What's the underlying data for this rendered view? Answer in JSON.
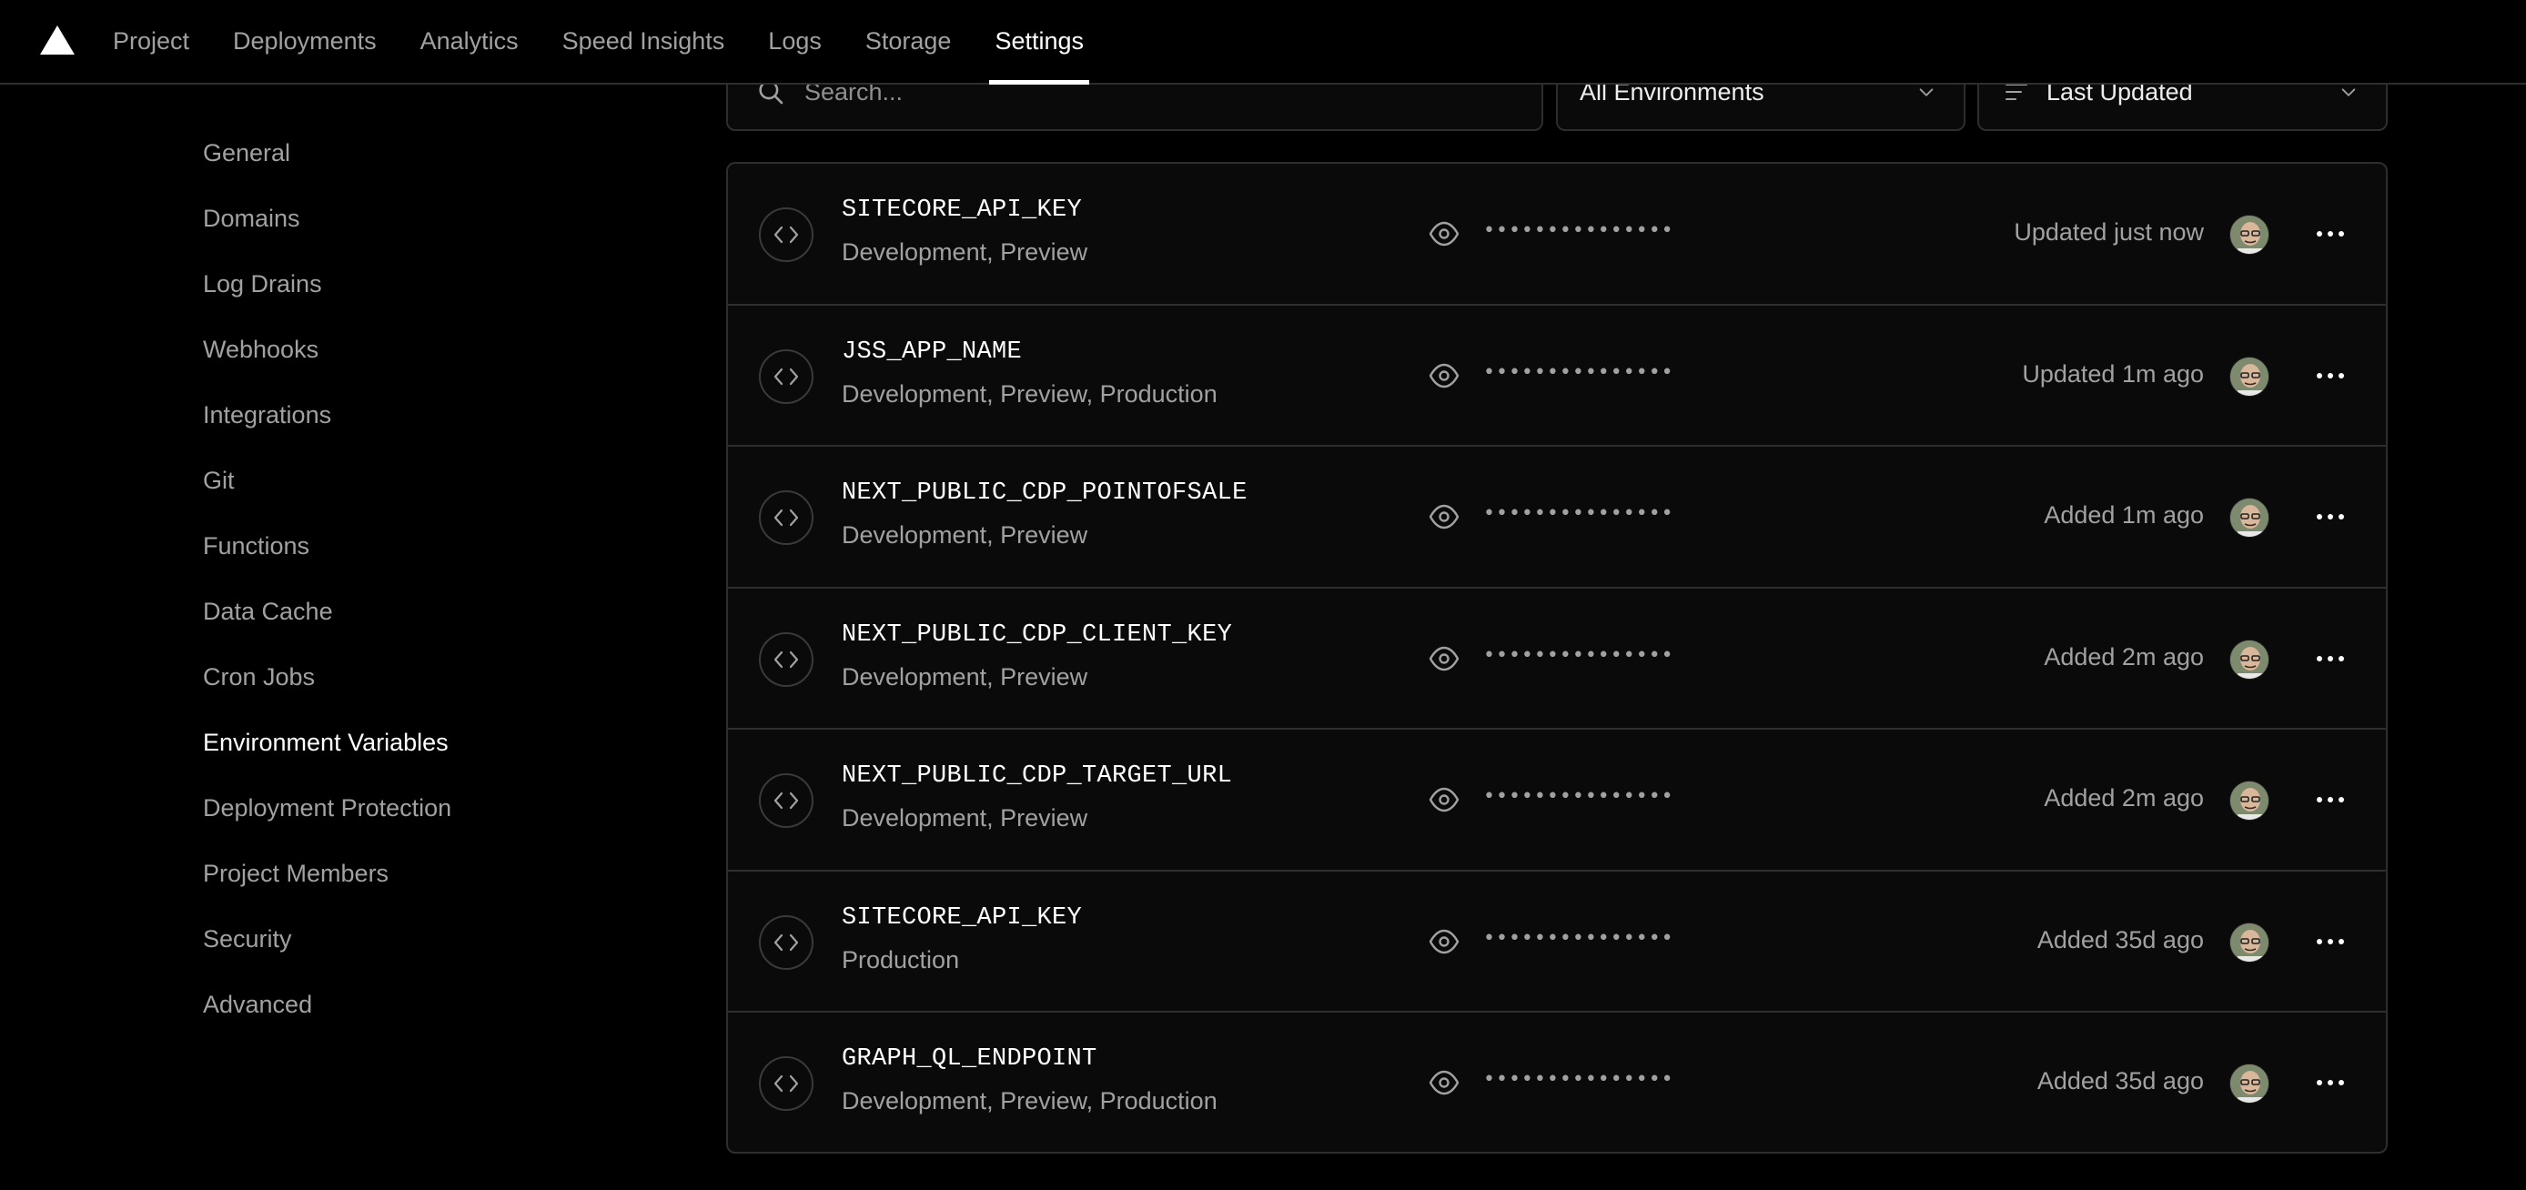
{
  "header": {
    "logo": "triangle-logo",
    "nav": [
      {
        "label": "Project",
        "active": false
      },
      {
        "label": "Deployments",
        "active": false
      },
      {
        "label": "Analytics",
        "active": false
      },
      {
        "label": "Speed Insights",
        "active": false
      },
      {
        "label": "Logs",
        "active": false
      },
      {
        "label": "Storage",
        "active": false
      },
      {
        "label": "Settings",
        "active": true
      }
    ]
  },
  "sidebar": {
    "items": [
      {
        "label": "General",
        "active": false
      },
      {
        "label": "Domains",
        "active": false
      },
      {
        "label": "Log Drains",
        "active": false
      },
      {
        "label": "Webhooks",
        "active": false
      },
      {
        "label": "Integrations",
        "active": false
      },
      {
        "label": "Git",
        "active": false
      },
      {
        "label": "Functions",
        "active": false
      },
      {
        "label": "Data Cache",
        "active": false
      },
      {
        "label": "Cron Jobs",
        "active": false
      },
      {
        "label": "Environment Variables",
        "active": true
      },
      {
        "label": "Deployment Protection",
        "active": false
      },
      {
        "label": "Project Members",
        "active": false
      },
      {
        "label": "Security",
        "active": false
      },
      {
        "label": "Advanced",
        "active": false
      }
    ]
  },
  "filters": {
    "search": {
      "placeholder": "Search...",
      "value": "",
      "icon": "search-icon"
    },
    "environment_select": {
      "value": "All Environments",
      "icon": "chevron-down-icon"
    },
    "sort_select": {
      "value": "Last Updated",
      "icon": "sort-lines-icon"
    }
  },
  "variables": [
    {
      "name": "SITECORE_API_KEY",
      "environments": "Development, Preview",
      "masked_value": "•••••••••••••••",
      "updated": "Updated just now"
    },
    {
      "name": "JSS_APP_NAME",
      "environments": "Development, Preview, Production",
      "masked_value": "•••••••••••••••",
      "updated": "Updated 1m ago"
    },
    {
      "name": "NEXT_PUBLIC_CDP_POINTOFSALE",
      "environments": "Development, Preview",
      "masked_value": "•••••••••••••••",
      "updated": "Added 1m ago"
    },
    {
      "name": "NEXT_PUBLIC_CDP_CLIENT_KEY",
      "environments": "Development, Preview",
      "masked_value": "•••••••••••••••",
      "updated": "Added 2m ago"
    },
    {
      "name": "NEXT_PUBLIC_CDP_TARGET_URL",
      "environments": "Development, Preview",
      "masked_value": "•••••••••••••••",
      "updated": "Added 2m ago"
    },
    {
      "name": "SITECORE_API_KEY",
      "environments": "Production",
      "masked_value": "•••••••••••••••",
      "updated": "Added 35d ago"
    },
    {
      "name": "GRAPH_QL_ENDPOINT",
      "environments": "Development, Preview, Production",
      "masked_value": "•••••••••••••••",
      "updated": "Added 35d ago"
    }
  ],
  "colors": {
    "background": "#000000",
    "surface": "#0a0a0a",
    "border": "#2e2e2e",
    "text_primary": "#ededed",
    "text_secondary": "#a1a1a1",
    "active": "#ffffff"
  }
}
